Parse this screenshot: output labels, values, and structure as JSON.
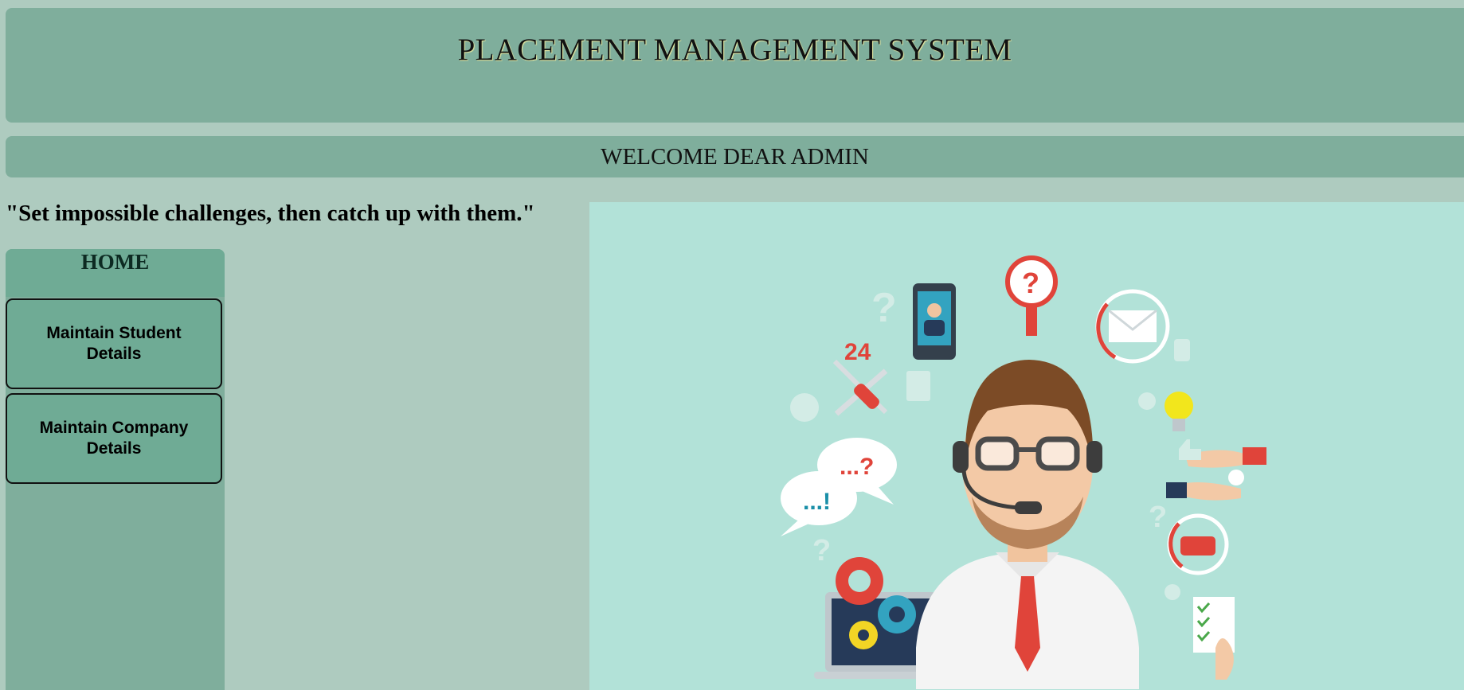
{
  "header": {
    "title": "PLACEMENT MANAGEMENT SYSTEM"
  },
  "welcome": {
    "text": "WELCOME DEAR ADMIN"
  },
  "quote": {
    "text": "\"Set impossible challenges, then catch up with them.\""
  },
  "sidebar": {
    "home_label": "HOME",
    "items": [
      {
        "label": "Maintain Student Details"
      },
      {
        "label": "Maintain Company Details"
      }
    ]
  },
  "hero": {
    "icon": "customer-support-illustration",
    "badge_24": "24",
    "bubble_question": "...?",
    "bubble_exclaim": "...!"
  },
  "colors": {
    "page_bg": "#aecbbf",
    "header_bg": "#7fae9c",
    "button_bg": "#6fab95",
    "hero_bg": "#b2e2d8",
    "accent_red": "#e0443a"
  }
}
